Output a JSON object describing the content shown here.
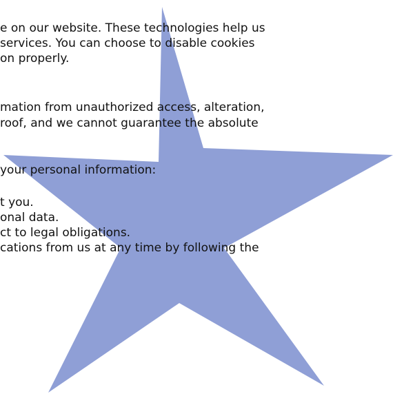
{
  "lines": [
    "e on our website. These technologies help us",
    "services. You can choose to disable cookies",
    "on properly.",
    "mation from unauthorized access, alteration,",
    "roof, and we cannot guarantee the absolute",
    "your personal information:",
    "t you.",
    "onal data.",
    "ct to legal obligations.",
    "cations from us at any time by following the"
  ],
  "colors": {
    "text": "#111111",
    "background": "#ffffff",
    "star_fill": "#8f9fd6"
  }
}
